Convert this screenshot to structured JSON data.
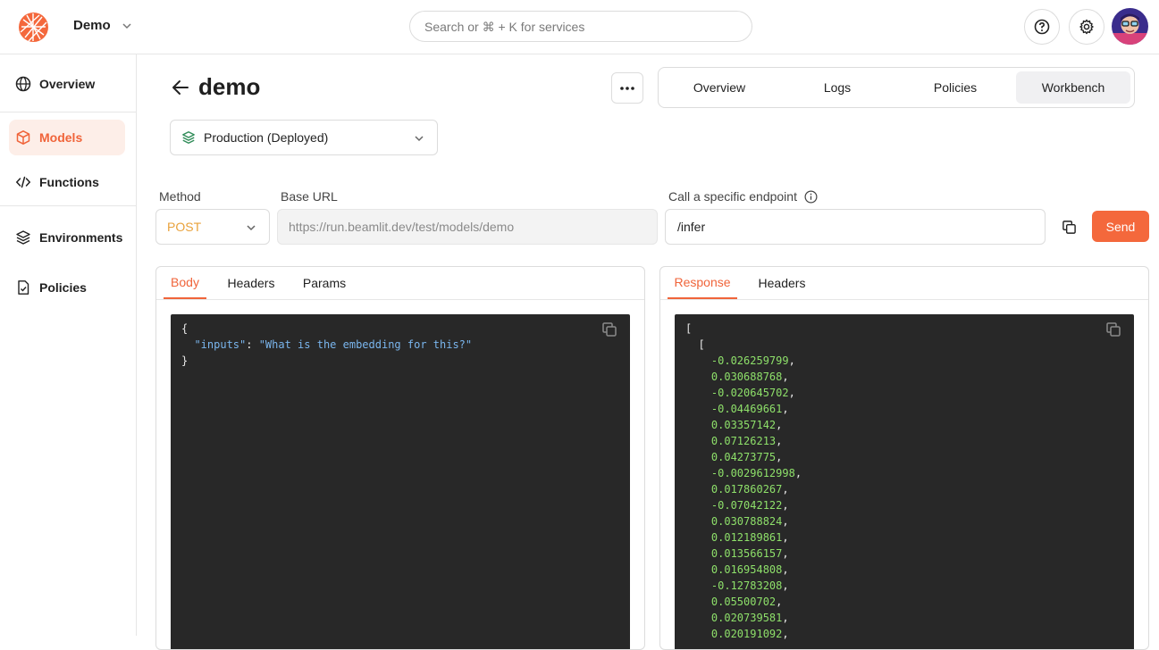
{
  "header": {
    "workspace": "Demo",
    "search_placeholder": "Search or ⌘ + K for services"
  },
  "sidebar": {
    "items": [
      {
        "label": "Overview",
        "icon": "globe-icon"
      },
      {
        "label": "Models",
        "icon": "cube-icon",
        "active": true
      },
      {
        "label": "Functions",
        "icon": "code-icon"
      },
      {
        "label": "Environments",
        "icon": "layers-icon"
      },
      {
        "label": "Policies",
        "icon": "document-check-icon"
      }
    ]
  },
  "page": {
    "title": "demo",
    "tabs": [
      "Overview",
      "Logs",
      "Policies",
      "Workbench"
    ],
    "active_tab": "Workbench",
    "environment": "Production (Deployed)"
  },
  "request": {
    "method_label": "Method",
    "method": "POST",
    "base_url_label": "Base URL",
    "base_url": "https://run.beamlit.dev/test/models/demo",
    "endpoint_label": "Call a specific endpoint",
    "endpoint": "/infer",
    "send_label": "Send"
  },
  "body_panel": {
    "tabs": [
      "Body",
      "Headers",
      "Params"
    ],
    "active_tab": "Body",
    "open_brace": "{",
    "key": "\"inputs\"",
    "value": "\"What is the embedding for this?\"",
    "close_brace": "}"
  },
  "response_panel": {
    "tabs": [
      "Response",
      "Headers"
    ],
    "active_tab": "Response",
    "open_outer": "[",
    "open_inner": "[",
    "values": [
      "-0.026259799",
      "0.030688768",
      "-0.020645702",
      "-0.04469661",
      "0.03357142",
      "0.07126213",
      "0.04273775",
      "-0.0029612998",
      "0.017860267",
      "-0.07042122",
      "0.030788824",
      "0.012189861",
      "0.013566157",
      "0.016954808",
      "-0.12783208",
      "0.05500702",
      "0.020739581",
      "0.020191092"
    ]
  },
  "colors": {
    "accent": "#f4683c",
    "method": "#e9a23b",
    "code_bg": "#282828",
    "code_string": "#7ab6ee",
    "code_number": "#8ee06a"
  }
}
